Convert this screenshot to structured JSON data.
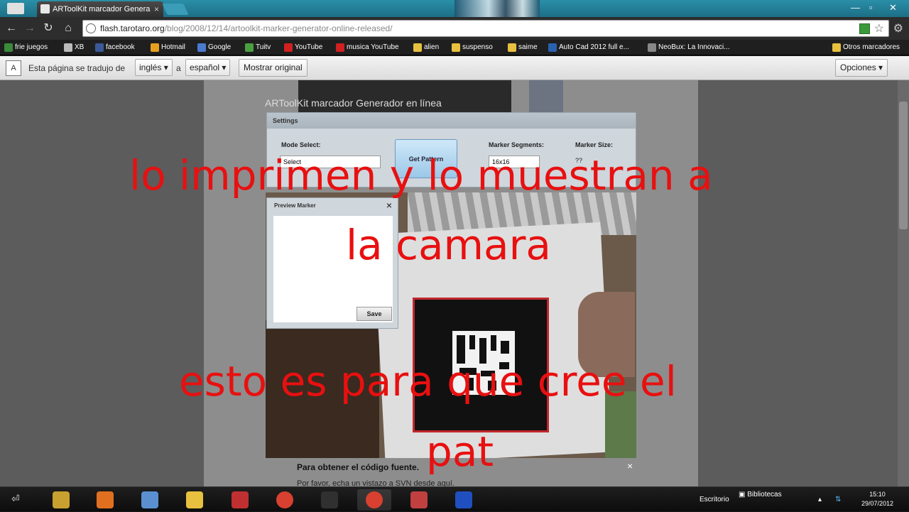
{
  "browser": {
    "tab_title": "ARToolKit marcador Genera",
    "tab_close": "×",
    "url_host": "flash.tarotaro.org",
    "url_path": "/blog/2008/12/14/artoolkit-marker-generator-online-released/"
  },
  "bookmarks": [
    {
      "label": "frie juegos",
      "color": "#3a8a3a"
    },
    {
      "label": "XB",
      "color": "#bbbbbb"
    },
    {
      "label": "facebook",
      "color": "#3b5998"
    },
    {
      "label": "Hotmail",
      "color": "#e8a020"
    },
    {
      "label": "Google",
      "color": "#4a7ad0"
    },
    {
      "label": "Tuitv",
      "color": "#4aa040"
    },
    {
      "label": "YouTube",
      "color": "#d02020"
    },
    {
      "label": "musica YouTube",
      "color": "#d02020"
    },
    {
      "label": "alien",
      "color": "#e8c040"
    },
    {
      "label": "suspenso",
      "color": "#e8c040"
    },
    {
      "label": "saime",
      "color": "#e8c040"
    },
    {
      "label": "Auto Cad 2012 full e...",
      "color": "#2a60b0"
    },
    {
      "label": "NeoBux: La Innovaci...",
      "color": "#888888"
    }
  ],
  "other_bookmarks": "Otros marcadores",
  "translate_bar": {
    "icon": "A",
    "text": "Esta página se tradujo de",
    "from": "inglés",
    "connector": "a",
    "to": "español",
    "show_original": "Mostrar original",
    "options": "Opciones"
  },
  "page": {
    "generator_title": "ARToolKit marcador Generador en línea",
    "settings_header": "Settings",
    "mode_select_label": "Mode Select:",
    "mode_select_value": "Select",
    "get_pattern": "Get Pattern",
    "marker_segments_label": "Marker Segments:",
    "marker_segments_value": "16x16",
    "marker_size_label": "Marker Size:",
    "marker_size_value": "??",
    "preview_header": "Preview Marker",
    "preview_close": "×",
    "save": "Save",
    "source_title": "Para obtener el código fuente.",
    "source_text": "Por favor, echa un vistazo a SVN desde aquí.",
    "close": "×"
  },
  "captions": {
    "line1": "lo imprimen y lo muestran a",
    "line2": "la camara",
    "line3": "esto es para que cree el",
    "line4": "pat"
  },
  "taskbar": {
    "desktop": "Escritorio",
    "libraries": "Bibliotecas",
    "time": "15:10",
    "date": "29/07/2012",
    "apps": [
      {
        "name": "libraries-app",
        "color": "#c8a030"
      },
      {
        "name": "media-player",
        "color": "#e07020"
      },
      {
        "name": "documents",
        "color": "#5a90d0"
      },
      {
        "name": "explorer",
        "color": "#e8c040"
      },
      {
        "name": "archive",
        "color": "#c03030"
      },
      {
        "name": "chrome",
        "color": "#d84030"
      },
      {
        "name": "game",
        "color": "#303030"
      },
      {
        "name": "chrome-active",
        "color": "#d84030"
      },
      {
        "name": "paint",
        "color": "#c04040"
      },
      {
        "name": "pattern-app",
        "color": "#2050c0"
      }
    ]
  }
}
